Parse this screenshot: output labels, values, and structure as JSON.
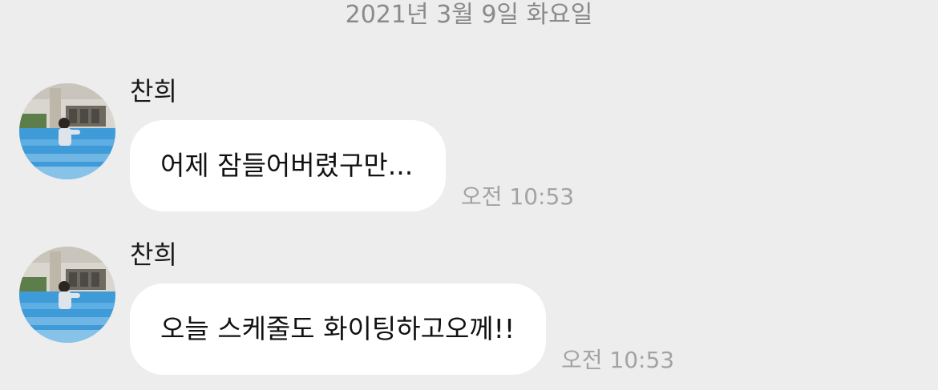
{
  "date_separator": "2021년 3월 9일 화요일",
  "messages": [
    {
      "sender": "찬희",
      "text": "어제 잠들어버렸구만...",
      "time": "오전 10:53"
    },
    {
      "sender": "찬희",
      "text": "오늘 스케줄도 화이팅하고오께!!",
      "time": "오전 10:53"
    }
  ],
  "colors": {
    "background": "#ededed",
    "bubble": "#ffffff",
    "timestamp": "#a3a3a3",
    "date_text": "#8a8a8a"
  }
}
